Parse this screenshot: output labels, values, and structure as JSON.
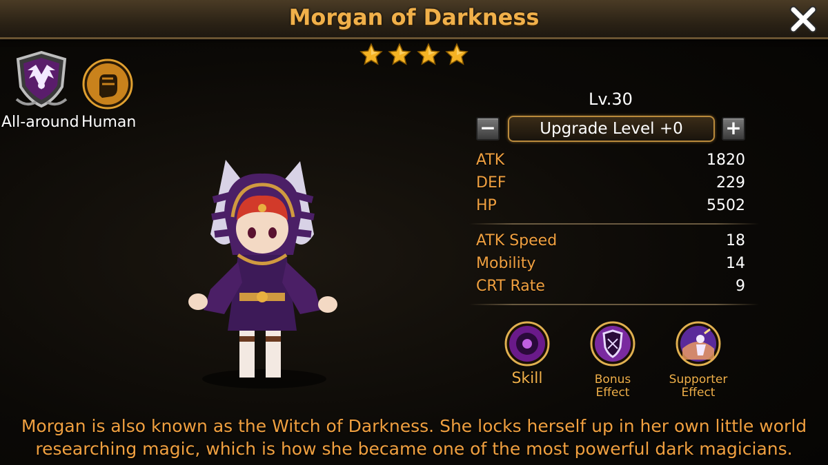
{
  "header": {
    "title": "Morgan of Darkness"
  },
  "stars": {
    "count": 4,
    "color": "#f5b324"
  },
  "badges": {
    "class_label": "All-around",
    "class_icon": "winged-shield-icon",
    "race_label": "Human",
    "race_icon": "fist-icon"
  },
  "stats": {
    "level": "Lv.30",
    "upgrade_label": "Upgrade Level +0",
    "minus_label": "−",
    "plus_label": "+",
    "primary": [
      {
        "name": "ATK",
        "value": "1820"
      },
      {
        "name": "DEF",
        "value": "229"
      },
      {
        "name": "HP",
        "value": "5502"
      }
    ],
    "secondary": [
      {
        "name": "ATK Speed",
        "value": "18"
      },
      {
        "name": "Mobility",
        "value": "14"
      },
      {
        "name": "CRT Rate",
        "value": "9"
      }
    ]
  },
  "abilities": [
    {
      "line1": "Skill",
      "line2": "",
      "icon": "dark-orb-icon"
    },
    {
      "line1": "Bonus",
      "line2": "Effect",
      "icon": "shield-icon"
    },
    {
      "line1": "Supporter",
      "line2": "Effect",
      "icon": "support-figure-icon"
    }
  ],
  "description": {
    "line1": "Morgan is also known as the Witch of Darkness. She locks herself up in her own little world",
    "line2": "researching magic, which is how she became one of the most powerful dark magicians."
  },
  "colors": {
    "accent": "#f0a040",
    "title": "#f0b04a",
    "header_bg": "#2c2316"
  }
}
